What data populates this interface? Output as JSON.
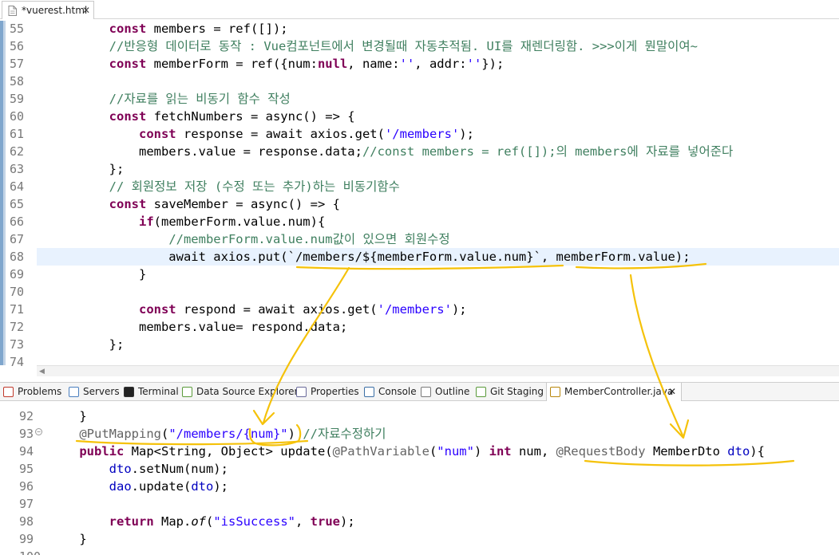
{
  "editor_tab": {
    "title": "*vuerest.html",
    "close": "✕"
  },
  "top_lines": [
    {
      "num": "55",
      "segs": [
        {
          "t": "        "
        },
        {
          "t": "const",
          "c": "kw"
        },
        {
          "t": " members = ref([]);"
        }
      ]
    },
    {
      "num": "56",
      "segs": [
        {
          "t": "        "
        },
        {
          "t": "//반응형 데이터로 동작 : Vue컴포넌트에서 변경될때 자동추적됨. UI를 재렌더링함. >>>이게 뭔말이여~",
          "c": "cm"
        }
      ]
    },
    {
      "num": "57",
      "segs": [
        {
          "t": "        "
        },
        {
          "t": "const",
          "c": "kw"
        },
        {
          "t": " memberForm = ref({num:"
        },
        {
          "t": "null",
          "c": "kw"
        },
        {
          "t": ", name:"
        },
        {
          "t": "''",
          "c": "str"
        },
        {
          "t": ", addr:"
        },
        {
          "t": "''",
          "c": "str"
        },
        {
          "t": "});"
        }
      ]
    },
    {
      "num": "58",
      "segs": []
    },
    {
      "num": "59",
      "segs": [
        {
          "t": "        "
        },
        {
          "t": "//자료를 읽는 비동기 함수 작성",
          "c": "cm"
        }
      ]
    },
    {
      "num": "60",
      "segs": [
        {
          "t": "        "
        },
        {
          "t": "const",
          "c": "kw"
        },
        {
          "t": " fetchNumbers = async() => {"
        }
      ]
    },
    {
      "num": "61",
      "segs": [
        {
          "t": "            "
        },
        {
          "t": "const",
          "c": "kw"
        },
        {
          "t": " response = await axios.get("
        },
        {
          "t": "'/members'",
          "c": "str"
        },
        {
          "t": ");"
        }
      ]
    },
    {
      "num": "62",
      "segs": [
        {
          "t": "            members.value = response.data;"
        },
        {
          "t": "//const members = ref([]);의 members에 자료를 넣어준다",
          "c": "cm"
        }
      ]
    },
    {
      "num": "63",
      "segs": [
        {
          "t": "        };"
        }
      ]
    },
    {
      "num": "64",
      "segs": [
        {
          "t": "        "
        },
        {
          "t": "// 회원정보 저장 (수정 또는 추가)하는 비동기함수",
          "c": "cm"
        }
      ]
    },
    {
      "num": "65",
      "segs": [
        {
          "t": "        "
        },
        {
          "t": "const",
          "c": "kw"
        },
        {
          "t": " saveMember = async() => {"
        }
      ]
    },
    {
      "num": "66",
      "segs": [
        {
          "t": "            "
        },
        {
          "t": "if",
          "c": "kw"
        },
        {
          "t": "(memberForm.value.num){"
        }
      ]
    },
    {
      "num": "67",
      "segs": [
        {
          "t": "                "
        },
        {
          "t": "//memberForm.value.num값이 있으면 회원수정",
          "c": "cm"
        }
      ]
    },
    {
      "num": "68",
      "segs": [
        {
          "t": "                await axios.put(`/members/${memberForm.value.num}`, memberForm.value);"
        }
      ]
    },
    {
      "num": "69",
      "segs": [
        {
          "t": "            }"
        }
      ]
    },
    {
      "num": "70",
      "segs": []
    },
    {
      "num": "71",
      "segs": [
        {
          "t": "            "
        },
        {
          "t": "const",
          "c": "kw"
        },
        {
          "t": " respond = await axios.get("
        },
        {
          "t": "'/members'",
          "c": "str"
        },
        {
          "t": ");"
        }
      ]
    },
    {
      "num": "72",
      "segs": [
        {
          "t": "            members.value= respond.data;"
        }
      ]
    },
    {
      "num": "73",
      "segs": [
        {
          "t": "        };"
        }
      ]
    },
    {
      "num": "74",
      "segs": []
    }
  ],
  "panel_tabs": [
    {
      "label": "Problems",
      "icon": "problems-icon"
    },
    {
      "label": "Servers",
      "icon": "servers-icon"
    },
    {
      "label": "Terminal",
      "icon": "terminal-icon"
    },
    {
      "label": "Data Source Explorer",
      "icon": "data-source-icon"
    },
    {
      "label": "Properties",
      "icon": "properties-icon"
    },
    {
      "label": "Console",
      "icon": "console-icon"
    },
    {
      "label": "Outline",
      "icon": "outline-icon"
    },
    {
      "label": "Git Staging",
      "icon": "git-staging-icon"
    },
    {
      "label": "MemberController.java",
      "icon": "java-file-icon",
      "close": "✕"
    }
  ],
  "bottom_lines": [
    {
      "num": "92",
      "segs": [
        {
          "t": "    }"
        }
      ]
    },
    {
      "num": "93",
      "fold": "⊖",
      "segs": [
        {
          "t": "    "
        },
        {
          "t": "@PutMapping",
          "c": "ann"
        },
        {
          "t": "("
        },
        {
          "t": "\"/members/{num}\"",
          "c": "str"
        },
        {
          "t": ") "
        },
        {
          "t": "//자료수정하기",
          "c": "cm"
        }
      ]
    },
    {
      "num": "94",
      "segs": [
        {
          "t": "    "
        },
        {
          "t": "public",
          "c": "kw"
        },
        {
          "t": " Map<String, Object> update("
        },
        {
          "t": "@PathVariable",
          "c": "ann"
        },
        {
          "t": "("
        },
        {
          "t": "\"num\"",
          "c": "str"
        },
        {
          "t": ") "
        },
        {
          "t": "int",
          "c": "kw"
        },
        {
          "t": " num, "
        },
        {
          "t": "@RequestBody",
          "c": "ann"
        },
        {
          "t": " MemberDto "
        },
        {
          "t": "dto",
          "c": "fld2"
        },
        {
          "t": "){"
        }
      ]
    },
    {
      "num": "95",
      "segs": [
        {
          "t": "        "
        },
        {
          "t": "dto",
          "c": "fld2"
        },
        {
          "t": ".setNum(num);"
        }
      ]
    },
    {
      "num": "96",
      "segs": [
        {
          "t": "        "
        },
        {
          "t": "dao",
          "c": "fld"
        },
        {
          "t": ".update("
        },
        {
          "t": "dto",
          "c": "fld2"
        },
        {
          "t": ");"
        }
      ]
    },
    {
      "num": "97",
      "segs": []
    },
    {
      "num": "98",
      "segs": [
        {
          "t": "        "
        },
        {
          "t": "return",
          "c": "kw"
        },
        {
          "t": " Map."
        },
        {
          "t": "of",
          "c": "mth"
        },
        {
          "t": "("
        },
        {
          "t": "\"isSuccess\"",
          "c": "str"
        },
        {
          "t": ", "
        },
        {
          "t": "true",
          "c": "kw"
        },
        {
          "t": ");"
        }
      ]
    },
    {
      "num": "99",
      "segs": [
        {
          "t": "    }"
        }
      ]
    },
    {
      "num": "100",
      "segs": []
    }
  ],
  "colors": {
    "annotation_ink": "#f5c20a",
    "keyword": "#7f0055",
    "string": "#2a00ff",
    "comment": "#3f7f5f",
    "field": "#0000c0"
  }
}
